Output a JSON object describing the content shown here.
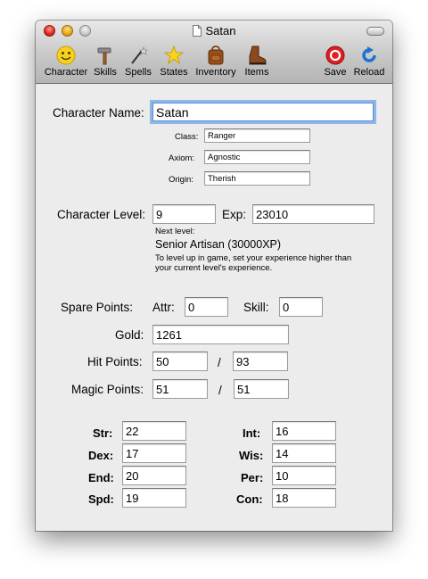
{
  "window": {
    "title": "Satan"
  },
  "toolbar": {
    "character": "Character",
    "skills": "Skills",
    "spells": "Spells",
    "states": "States",
    "inventory": "Inventory",
    "items": "Items",
    "save": "Save",
    "reload": "Reload"
  },
  "character": {
    "name_label": "Character Name:",
    "name": "Satan",
    "class_label": "Class:",
    "class": "Ranger",
    "axiom_label": "Axiom:",
    "axiom": "Agnostic",
    "origin_label": "Origin:",
    "origin": "Therish"
  },
  "level": {
    "level_label": "Character Level:",
    "level": "9",
    "exp_label": "Exp:",
    "exp": "23010",
    "next_label": "Next level:",
    "next_title": "Senior Artisan (30000XP)",
    "hint_line1": "To level up in game, set your experience higher than",
    "hint_line2": "your current level's experience."
  },
  "points": {
    "spare_label": "Spare Points:",
    "attr_label": "Attr:",
    "attr": "0",
    "skill_label": "Skill:",
    "skill": "0",
    "gold_label": "Gold:",
    "gold": "1261",
    "hp_label": "Hit Points:",
    "hp": "50",
    "hp_max": "93",
    "mp_label": "Magic Points:",
    "mp": "51",
    "mp_max": "51",
    "slash": "/"
  },
  "attributes": {
    "str_label": "Str:",
    "str": "22",
    "dex_label": "Dex:",
    "dex": "17",
    "end_label": "End:",
    "end": "20",
    "spd_label": "Spd:",
    "spd": "19",
    "int_label": "Int:",
    "int": "16",
    "wis_label": "Wis:",
    "wis": "14",
    "per_label": "Per:",
    "per": "10",
    "con_label": "Con:",
    "con": "18"
  }
}
